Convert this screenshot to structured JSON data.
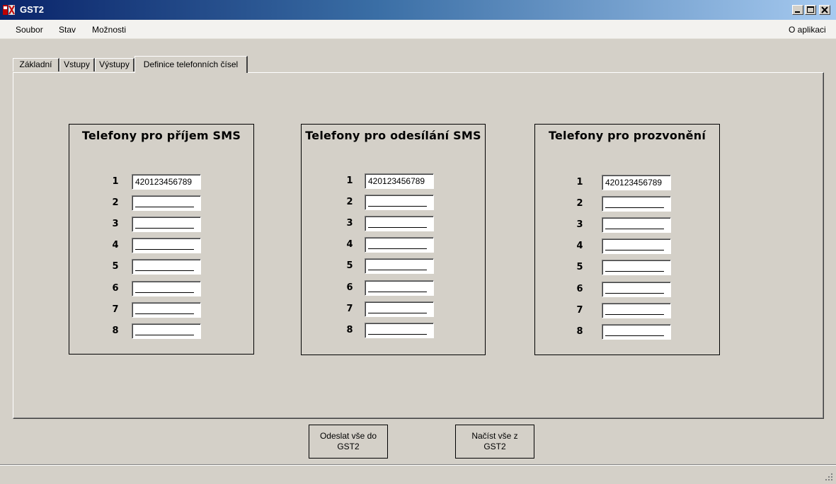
{
  "window": {
    "title": "GST2"
  },
  "menu": {
    "items": [
      "Soubor",
      "Stav",
      "Možnosti"
    ],
    "about": "O aplikaci"
  },
  "tabs": [
    {
      "label": "Základní",
      "active": false
    },
    {
      "label": "Vstupy",
      "active": false
    },
    {
      "label": "Výstupy",
      "active": false
    },
    {
      "label": "Definice telefonních čísel",
      "active": true
    }
  ],
  "groups": [
    {
      "title": "Telefony pro příjem SMS",
      "rows": [
        {
          "num": "1",
          "value": "420123456789"
        },
        {
          "num": "2",
          "value": ""
        },
        {
          "num": "3",
          "value": ""
        },
        {
          "num": "4",
          "value": ""
        },
        {
          "num": "5",
          "value": ""
        },
        {
          "num": "6",
          "value": ""
        },
        {
          "num": "7",
          "value": ""
        },
        {
          "num": "8",
          "value": ""
        }
      ]
    },
    {
      "title": "Telefony pro odesílání SMS",
      "rows": [
        {
          "num": "1",
          "value": "420123456789"
        },
        {
          "num": "2",
          "value": ""
        },
        {
          "num": "3",
          "value": ""
        },
        {
          "num": "4",
          "value": ""
        },
        {
          "num": "5",
          "value": ""
        },
        {
          "num": "6",
          "value": ""
        },
        {
          "num": "7",
          "value": ""
        },
        {
          "num": "8",
          "value": ""
        }
      ]
    },
    {
      "title": "Telefony pro prozvonění",
      "rows": [
        {
          "num": "1",
          "value": "420123456789"
        },
        {
          "num": "2",
          "value": ""
        },
        {
          "num": "3",
          "value": ""
        },
        {
          "num": "4",
          "value": ""
        },
        {
          "num": "5",
          "value": ""
        },
        {
          "num": "6",
          "value": ""
        },
        {
          "num": "7",
          "value": ""
        },
        {
          "num": "8",
          "value": ""
        }
      ]
    }
  ],
  "buttons": {
    "send_all": "Odeslat vše do GST2",
    "load_all": "Načíst vše z GST2"
  },
  "icons": {
    "app": "phone-app-icon",
    "minimize": "minimize-icon",
    "maximize": "maximize-icon",
    "close": "close-icon",
    "grip": "resize-grip-icon"
  }
}
